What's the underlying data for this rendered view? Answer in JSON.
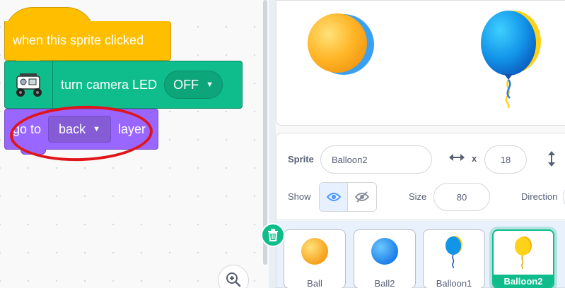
{
  "code_area": {
    "hat_block": {
      "text": "when this sprite clicked",
      "color": "#FFBF00"
    },
    "camera_block": {
      "text": "turn camera LED",
      "value": "OFF",
      "color": "#0FBD8C",
      "icon": "robot-car-icon"
    },
    "layer_block": {
      "prefix": "go to",
      "value": "back",
      "suffix": "layer",
      "color": "#9966FF"
    },
    "annotation_color": "#E0151A",
    "zoom_icon": "zoom-in-icon"
  },
  "stage": {
    "sprites": [
      "ball-sprite",
      "balloon-sprite"
    ]
  },
  "sprite_info": {
    "sprite_label": "Sprite",
    "sprite_name": "Balloon2",
    "x_label": "x",
    "x_value": "18",
    "show_label": "Show",
    "size_label": "Size",
    "size_value": "80",
    "direction_label": "Direction"
  },
  "sprite_list": {
    "items": [
      {
        "name": "Ball",
        "selected": false
      },
      {
        "name": "Ball2",
        "selected": false
      },
      {
        "name": "Balloon1",
        "selected": false
      },
      {
        "name": "Balloon2",
        "selected": true
      }
    ],
    "selected_color": "#0FBD8C",
    "delete_icon": "trash-icon"
  }
}
